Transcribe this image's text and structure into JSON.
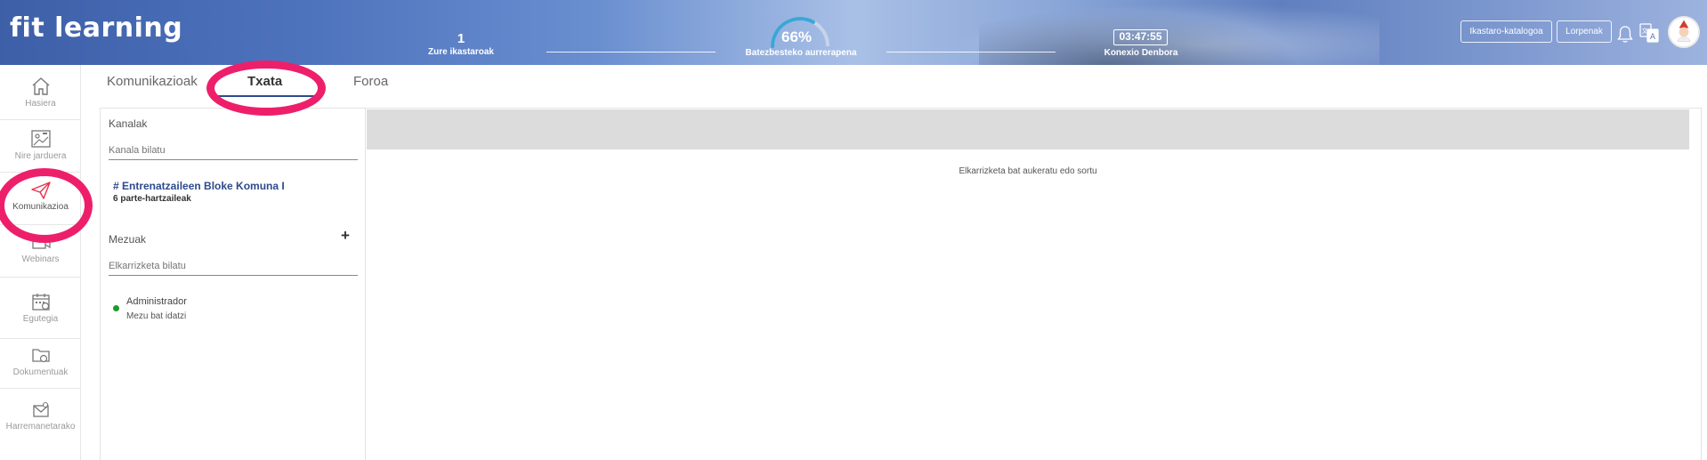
{
  "header": {
    "logo": "fit learning",
    "courses_count": "1",
    "courses_label": "Zure ikastaroak",
    "progress_value": "66%",
    "progress_fraction": 0.66,
    "progress_label": "Batezbesteko aurrerapena",
    "connection_time": "03:47:55",
    "connection_label": "Konexio Denbora",
    "catalog_button": "Ikastaro-katalogoa",
    "achievements_button": "Lorpenak",
    "icons": [
      "bell-icon",
      "translate-icon"
    ],
    "colors": {
      "accent": "#3aa6d8",
      "progress_track": "#c7d3ea"
    }
  },
  "sidebar": {
    "items": [
      {
        "label": "Hasiera",
        "icon": "home-icon"
      },
      {
        "label": "Nire jarduera",
        "icon": "activity-icon"
      },
      {
        "label": "Komunikazioa",
        "icon": "send-icon",
        "active": true
      },
      {
        "label": "Webinars",
        "icon": "video-icon"
      },
      {
        "label": "Egutegia",
        "icon": "calendar-icon"
      },
      {
        "label": "Dokumentuak",
        "icon": "folder-icon"
      },
      {
        "label": "Harremanetarako",
        "icon": "mail-icon"
      }
    ],
    "colors": {
      "active_icon": "#e8304a"
    }
  },
  "tabs": [
    {
      "label": "Komunikazioak"
    },
    {
      "label": "Txata",
      "active": true
    },
    {
      "label": "Foroa"
    }
  ],
  "chat": {
    "channels_title": "Kanalak",
    "channels_search_placeholder": "Kanala bilatu",
    "channel": {
      "name": "# Entrenatzaileen Bloke Komuna I",
      "participants": "6 parte-hartzaileak"
    },
    "messages_title": "Mezuak",
    "messages_search_placeholder": "Elkarrizketa bilatu",
    "conversation": {
      "name": "Administrador",
      "subtitle": "Mezu bat idatzi",
      "status_color": "#1a9b2a"
    },
    "empty_message": "Elkarrizketa bat aukeratu edo sortu"
  },
  "annotations": {
    "highlight_color": "#ee1f6a"
  }
}
